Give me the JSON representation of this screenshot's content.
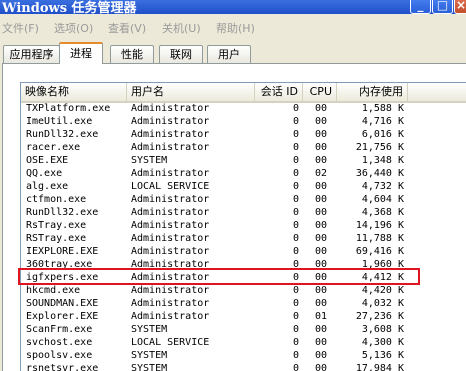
{
  "window": {
    "title": "Windows 任务管理器"
  },
  "title_buttons": {
    "minimize": "_",
    "maximize": "□",
    "close": "×"
  },
  "menu": [
    {
      "label": "文件(F)"
    },
    {
      "label": "选项(O)"
    },
    {
      "label": "查看(V)"
    },
    {
      "label": "关机(U)"
    },
    {
      "label": "帮助(H)"
    }
  ],
  "tabs": [
    {
      "label": "应用程序",
      "active": false
    },
    {
      "label": "进程",
      "active": true
    },
    {
      "label": "性能",
      "active": false
    },
    {
      "label": "联网",
      "active": false
    },
    {
      "label": "用户",
      "active": false
    }
  ],
  "columns": {
    "image": "映像名称",
    "user": "用户名",
    "session": "会话 ID",
    "cpu": "CPU",
    "mem": "内存使用"
  },
  "processes": [
    {
      "image": "TXPlatform.exe",
      "user": "Administrator",
      "session": "0",
      "cpu": "00",
      "mem": "1,588 K"
    },
    {
      "image": "ImeUtil.exe",
      "user": "Administrator",
      "session": "0",
      "cpu": "00",
      "mem": "4,716 K"
    },
    {
      "image": "RunDll32.exe",
      "user": "Administrator",
      "session": "0",
      "cpu": "00",
      "mem": "6,016 K"
    },
    {
      "image": "racer.exe",
      "user": "Administrator",
      "session": "0",
      "cpu": "00",
      "mem": "21,756 K"
    },
    {
      "image": "OSE.EXE",
      "user": "SYSTEM",
      "session": "0",
      "cpu": "00",
      "mem": "1,348 K"
    },
    {
      "image": "QQ.exe",
      "user": "Administrator",
      "session": "0",
      "cpu": "02",
      "mem": "36,440 K"
    },
    {
      "image": "alg.exe",
      "user": "LOCAL SERVICE",
      "session": "0",
      "cpu": "00",
      "mem": "4,732 K"
    },
    {
      "image": "ctfmon.exe",
      "user": "Administrator",
      "session": "0",
      "cpu": "00",
      "mem": "4,604 K"
    },
    {
      "image": "RunDll32.exe",
      "user": "Administrator",
      "session": "0",
      "cpu": "00",
      "mem": "4,368 K"
    },
    {
      "image": "RsTray.exe",
      "user": "Administrator",
      "session": "0",
      "cpu": "00",
      "mem": "14,196 K"
    },
    {
      "image": "RSTray.exe",
      "user": "Administrator",
      "session": "0",
      "cpu": "00",
      "mem": "11,788 K"
    },
    {
      "image": "IEXPLORE.EXE",
      "user": "Administrator",
      "session": "0",
      "cpu": "00",
      "mem": "69,416 K"
    },
    {
      "image": "360tray.exe",
      "user": "Administrator",
      "session": "0",
      "cpu": "00",
      "mem": "1,960 K"
    },
    {
      "image": "igfxpers.exe",
      "user": "Administrator",
      "session": "0",
      "cpu": "00",
      "mem": "4,412 K"
    },
    {
      "image": "hkcmd.exe",
      "user": "Administrator",
      "session": "0",
      "cpu": "00",
      "mem": "4,420 K"
    },
    {
      "image": "SOUNDMAN.EXE",
      "user": "Administrator",
      "session": "0",
      "cpu": "00",
      "mem": "4,032 K"
    },
    {
      "image": "Explorer.EXE",
      "user": "Administrator",
      "session": "0",
      "cpu": "01",
      "mem": "27,236 K"
    },
    {
      "image": "ScanFrm.exe",
      "user": "SYSTEM",
      "session": "0",
      "cpu": "00",
      "mem": "3,608 K"
    },
    {
      "image": "svchost.exe",
      "user": "LOCAL SERVICE",
      "session": "0",
      "cpu": "00",
      "mem": "4,300 K"
    },
    {
      "image": "spoolsv.exe",
      "user": "SYSTEM",
      "session": "0",
      "cpu": "00",
      "mem": "5,136 K"
    },
    {
      "image": "rsnetsvr.exe",
      "user": "SYSTEM",
      "session": "0",
      "cpu": "00",
      "mem": "17,984 K"
    }
  ],
  "highlighted_process": "igfxpers.exe",
  "colors": {
    "titlebar": "#2456d4",
    "highlight_box": "#e0141e",
    "active_tab_accent": "#e68b2c"
  }
}
